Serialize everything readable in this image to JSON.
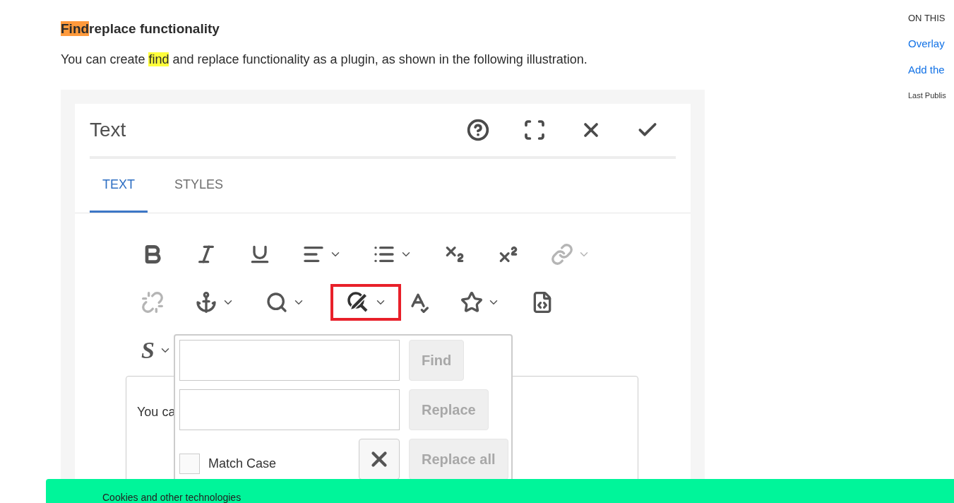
{
  "article": {
    "heading": [
      {
        "text": "Find",
        "highlighted": true,
        "current": true
      },
      {
        "text": "replace functionality",
        "highlighted": false,
        "current": false
      }
    ],
    "paragraph": [
      {
        "text": "You can create ",
        "highlighted": false,
        "current": false
      },
      {
        "text": "find",
        "highlighted": true,
        "current": false
      },
      {
        "text": " and replace functionality as a plugin, as shown in the following illustration.",
        "highlighted": false,
        "current": false
      }
    ]
  },
  "dialog": {
    "title": "Text",
    "actions": [
      {
        "kind": "help"
      },
      {
        "kind": "fullscreen"
      },
      {
        "kind": "close"
      },
      {
        "kind": "done"
      }
    ],
    "tabs": [
      {
        "label": "TEXT",
        "selected": true
      },
      {
        "label": "STYLES",
        "selected": false
      }
    ],
    "toolbar": [
      [
        {
          "kind": "bold",
          "dropdown": false,
          "disabled": false,
          "selected": false
        },
        {
          "kind": "italic",
          "dropdown": false,
          "disabled": false,
          "selected": false
        },
        {
          "kind": "underline",
          "dropdown": false,
          "disabled": false,
          "selected": false
        },
        {
          "kind": "align",
          "dropdown": true,
          "disabled": false,
          "selected": false
        },
        {
          "kind": "list",
          "dropdown": true,
          "disabled": false,
          "selected": false
        },
        {
          "kind": "subscript",
          "dropdown": false,
          "disabled": false,
          "selected": false
        },
        {
          "kind": "superscript",
          "dropdown": false,
          "disabled": false,
          "selected": false
        },
        {
          "kind": "link",
          "dropdown": true,
          "disabled": true,
          "selected": false
        }
      ],
      [
        {
          "kind": "unlink",
          "dropdown": false,
          "disabled": true,
          "selected": false
        },
        {
          "kind": "anchor",
          "dropdown": true,
          "disabled": false,
          "selected": false
        },
        {
          "kind": "find",
          "dropdown": true,
          "disabled": false,
          "selected": false
        },
        {
          "kind": "replace",
          "dropdown": true,
          "disabled": false,
          "selected": true
        },
        {
          "kind": "spellcheck",
          "dropdown": false,
          "disabled": false,
          "selected": false
        },
        {
          "kind": "star",
          "dropdown": true,
          "disabled": false,
          "selected": false
        },
        {
          "kind": "source",
          "dropdown": false,
          "disabled": false,
          "selected": false
        }
      ],
      [
        {
          "kind": "styles",
          "label": "S",
          "dropdown": true,
          "disabled": false,
          "selected": false
        }
      ]
    ],
    "editor_text": "You ca",
    "find_replace": {
      "find_button": "Find",
      "replace_button": "Replace",
      "replace_all_button": "Replace all",
      "match_case": {
        "label": "Match Case",
        "checked": false
      }
    }
  },
  "sidebar": {
    "title": "ON THIS",
    "links": [
      "Overlay",
      "Add the"
    ],
    "note": "Last Publis"
  },
  "cookie_banner": {
    "text": "Cookies and other technologies"
  }
}
